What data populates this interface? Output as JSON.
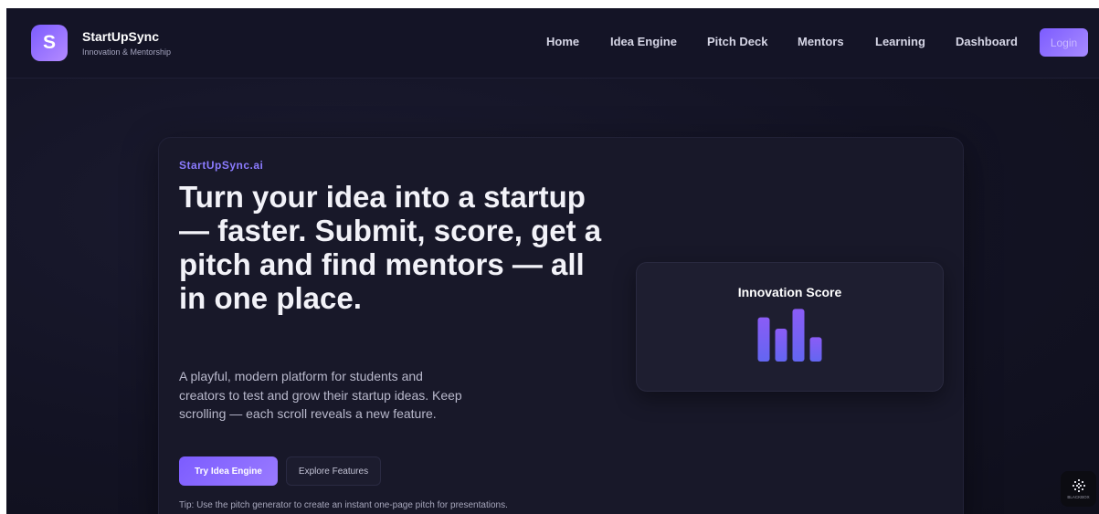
{
  "header": {
    "logo_letter": "S",
    "brand_name": "StartUpSync",
    "brand_tagline": "Innovation & Mentorship",
    "nav": [
      {
        "label": "Home"
      },
      {
        "label": "Idea Engine"
      },
      {
        "label": "Pitch Deck"
      },
      {
        "label": "Mentors"
      },
      {
        "label": "Learning"
      },
      {
        "label": "Dashboard"
      }
    ],
    "login_label": "Login"
  },
  "hero": {
    "eyebrow": "StartUpSync.ai",
    "headline": "Turn your idea into a startup — faster. Submit, score, get a pitch and find mentors — all in one place.",
    "subtext": "A playful, modern platform for students and creators to test and grow their startup ideas. Keep scrolling — each scroll reveals a new feature.",
    "primary_cta": "Try Idea Engine",
    "secondary_cta": "Explore Features",
    "tip": "Tip: Use the pitch generator to create an instant one-page pitch for presentations."
  },
  "score_card": {
    "title": "Innovation Score",
    "bars": [
      0.78,
      0.58,
      0.93,
      0.43
    ]
  },
  "widget": {
    "icon": "blackbox-logo-icon",
    "label": "BLACKBOX"
  },
  "colors": {
    "accent": "#7c5cff",
    "accent_light": "#a88bff",
    "background": "#131324",
    "card": "#181829"
  }
}
